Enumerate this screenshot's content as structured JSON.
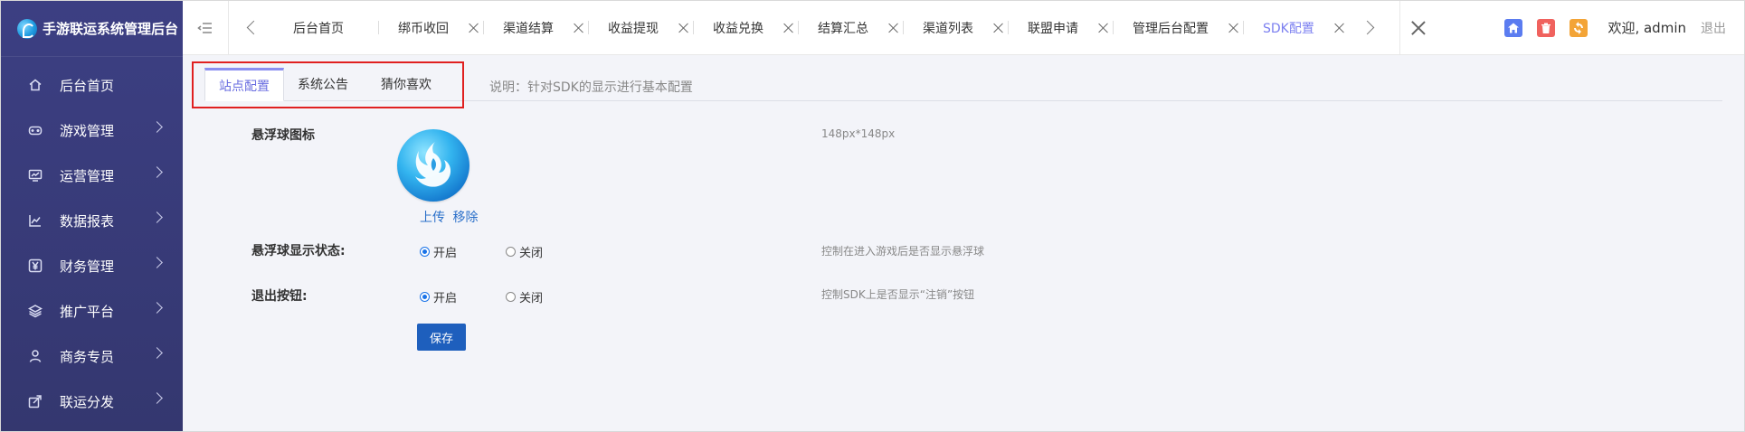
{
  "brand": {
    "title": "手游联运系统管理后台"
  },
  "sidebar": {
    "items": [
      {
        "label": "后台首页",
        "icon": "home-icon",
        "has_arrow": false
      },
      {
        "label": "游戏管理",
        "icon": "gamepad-icon",
        "has_arrow": true
      },
      {
        "label": "运营管理",
        "icon": "monitor-chart-icon",
        "has_arrow": true
      },
      {
        "label": "数据报表",
        "icon": "line-chart-icon",
        "has_arrow": true
      },
      {
        "label": "财务管理",
        "icon": "yen-icon",
        "has_arrow": true
      },
      {
        "label": "推广平台",
        "icon": "layers-icon",
        "has_arrow": true
      },
      {
        "label": "商务专员",
        "icon": "user-icon",
        "has_arrow": true
      },
      {
        "label": "联运分发",
        "icon": "share-icon",
        "has_arrow": true
      }
    ]
  },
  "topbar": {
    "tabs": [
      {
        "label": "后台首页",
        "closable": false,
        "active": false
      },
      {
        "label": "绑币收回",
        "closable": true,
        "active": false
      },
      {
        "label": "渠道结算",
        "closable": true,
        "active": false
      },
      {
        "label": "收益提现",
        "closable": true,
        "active": false
      },
      {
        "label": "收益兑换",
        "closable": true,
        "active": false
      },
      {
        "label": "结算汇总",
        "closable": true,
        "active": false
      },
      {
        "label": "渠道列表",
        "closable": true,
        "active": false
      },
      {
        "label": "联盟申请",
        "closable": true,
        "active": false
      },
      {
        "label": "管理后台配置",
        "closable": true,
        "active": false
      },
      {
        "label": "SDK配置",
        "closable": true,
        "active": true
      }
    ],
    "welcome": "欢迎, admin",
    "logout": "退出"
  },
  "page": {
    "subtabs": [
      "站点配置",
      "系统公告",
      "猜你喜欢"
    ],
    "active_subtab": 0,
    "description": "说明：针对SDK的显示进行基本配置",
    "float_icon": {
      "label": "悬浮球图标",
      "size_hint": "148px*148px",
      "upload": "上传",
      "remove": "移除"
    },
    "float_status": {
      "label": "悬浮球显示状态:",
      "on": "开启",
      "off": "关闭",
      "value": "on",
      "hint": "控制在进入游戏后是否显示悬浮球"
    },
    "exit_button": {
      "label": "退出按钮:",
      "on": "开启",
      "off": "关闭",
      "value": "on",
      "hint": "控制SDK上是否显示“注销”按钮"
    },
    "save": "保存"
  },
  "colors": {
    "sidebar_bg": "#3c3f83",
    "active_tab": "#7b7ff0",
    "primary_button": "#1e5fbd",
    "highlight_box": "#e02020",
    "link": "#2a6fc9"
  }
}
